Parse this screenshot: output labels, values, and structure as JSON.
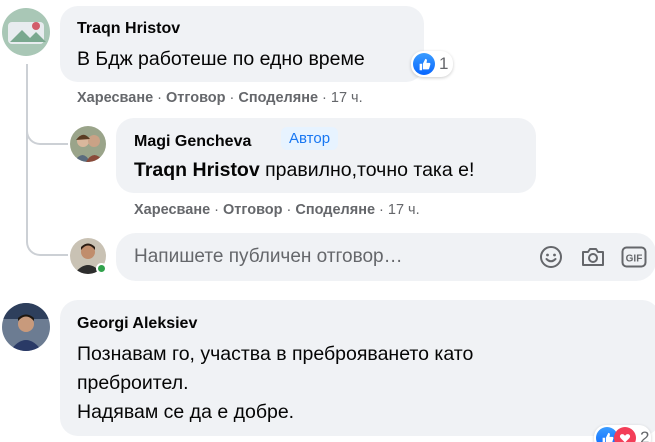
{
  "comments": [
    {
      "author": "Traqn Hristov",
      "text": "В Бдж работеше по едно време",
      "reaction_count": "1",
      "actions": {
        "like": "Харесване",
        "reply": "Отговор",
        "share": "Споделяне",
        "time": "17 ч."
      }
    },
    {
      "author": "Georgi Aleksiev",
      "lines": [
        "Познавам го, участва в преброяването като",
        "преброител.",
        "Надявам се да е добре."
      ],
      "reaction_count_partial": "2"
    }
  ],
  "reply": {
    "author": "Magi Gencheva",
    "badge": "Автор",
    "mention": "Traqn Hristov",
    "text": " правилно,точно така е!",
    "actions": {
      "like": "Харесване",
      "reply": "Отговор",
      "share": "Споделяне",
      "time": "17 ч."
    }
  },
  "composer": {
    "placeholder": "Напишете публичен отговор…"
  },
  "separator": "·",
  "colors": {
    "bubble": "#f0f2f5",
    "link_blue": "#1877f2",
    "secondary_text": "#65676b",
    "online": "#31a24c"
  }
}
